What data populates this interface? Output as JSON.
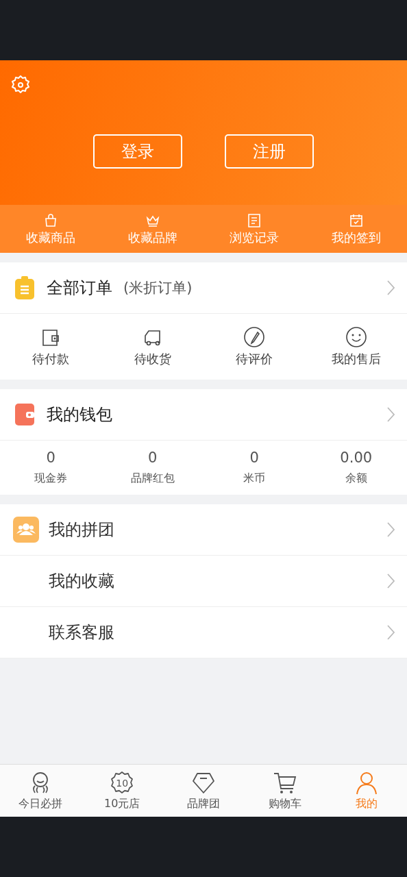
{
  "header": {
    "buttons": [
      "登录",
      "注册"
    ]
  },
  "quick_links": [
    {
      "label": "收藏商品"
    },
    {
      "label": "收藏品牌"
    },
    {
      "label": "浏览记录"
    },
    {
      "label": "我的签到"
    }
  ],
  "orders": {
    "title": "全部订单",
    "subtitle": "(米折订单)",
    "statuses": [
      {
        "label": "待付款"
      },
      {
        "label": "待收货"
      },
      {
        "label": "待评价"
      },
      {
        "label": "我的售后"
      }
    ]
  },
  "wallet": {
    "title": "我的钱包",
    "stats": [
      {
        "value": "0",
        "label": "现金券"
      },
      {
        "value": "0",
        "label": "品牌红包"
      },
      {
        "value": "0",
        "label": "米币"
      },
      {
        "value": "0.00",
        "label": "余额"
      }
    ]
  },
  "menu": [
    {
      "label": "我的拼团"
    },
    {
      "label": "我的收藏"
    },
    {
      "label": "联系客服"
    }
  ],
  "tab_bar": [
    {
      "label": "今日必拼",
      "selected": false
    },
    {
      "label": "10元店",
      "selected": false,
      "icon_text": "10"
    },
    {
      "label": "品牌团",
      "selected": false
    },
    {
      "label": "购物车",
      "selected": false
    },
    {
      "label": "我的",
      "selected": true
    }
  ]
}
